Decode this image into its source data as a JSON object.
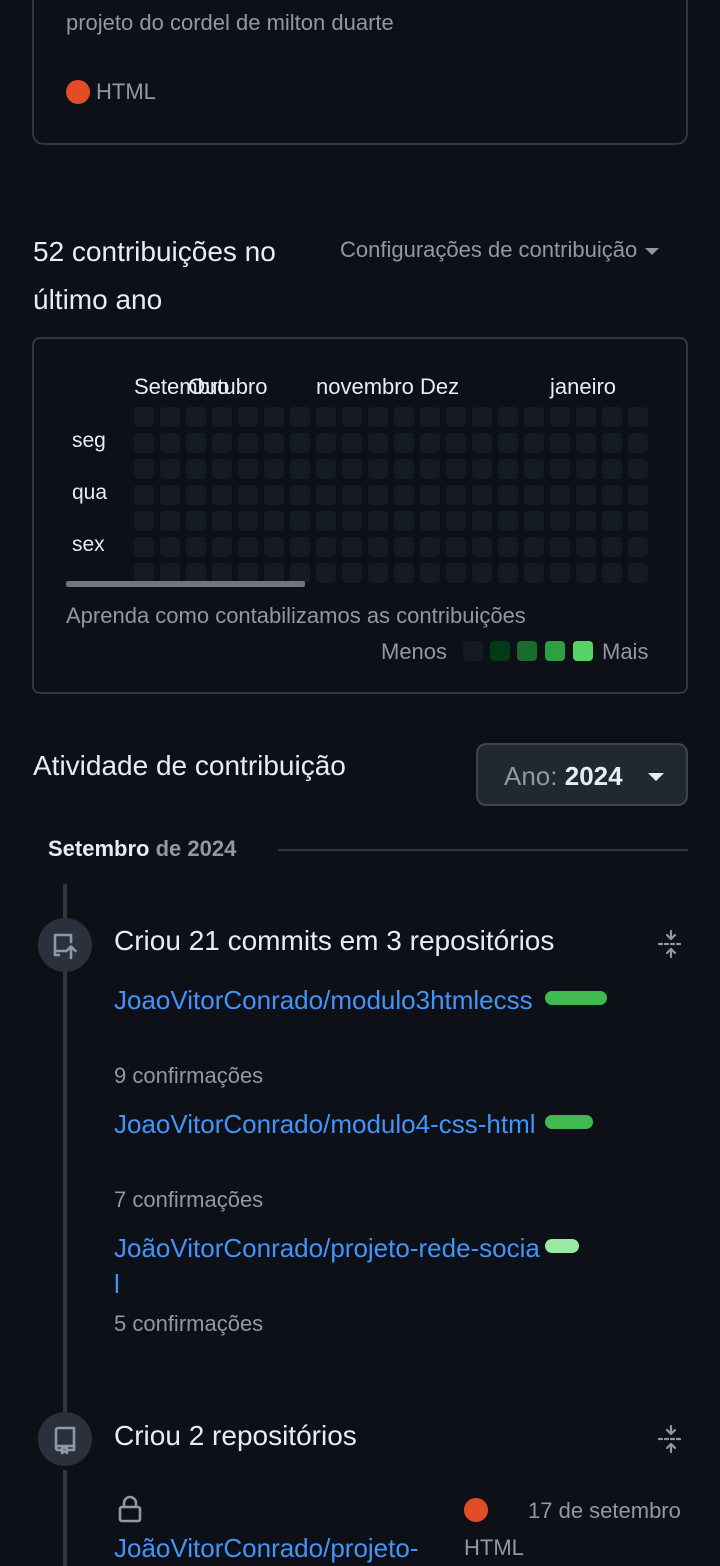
{
  "repo_card": {
    "description": "projeto do cordel de milton duarte",
    "language": "HTML",
    "language_color": "#e34c26"
  },
  "contributions": {
    "heading": "52 contribuições no último ano",
    "settings_label": "Configurações de contribuição",
    "months": [
      "Setembro",
      "Outubro",
      "novembro",
      "Dez",
      "janeiro"
    ],
    "days": [
      "seg",
      "qua",
      "sex"
    ],
    "learn_link": "Aprenda como contabilizamos as contribuições",
    "legend_less": "Menos",
    "legend_more": "Mais",
    "legend_colors": [
      "#151b23",
      "#033a16",
      "#196c2e",
      "#2ea043",
      "#56d364"
    ]
  },
  "activity": {
    "title": "Atividade de contribuição",
    "year_label": "Ano:",
    "year_value": "2024",
    "month_name": "Setembro",
    "month_year": "de 2024",
    "commits_event": {
      "title": "Criou 21 commits em 3 repositórios",
      "repos": [
        {
          "name": "JoaoVitorConrado/modulo3htmlecss",
          "commits": "9 confirmações",
          "level": 9
        },
        {
          "name": "JoaoVitorConrado/modulo4-css-html",
          "commits": "7 confirmações",
          "level": 7
        },
        {
          "name": "JoãoVitorConrado/projeto-rede-social",
          "commits": "5 confirmações",
          "level": 5
        }
      ]
    },
    "repos_event": {
      "title": "Criou 2 repositórios",
      "repo_name": "JoãoVitorConrado/projeto-",
      "language": "HTML",
      "date": "17 de setembro"
    }
  }
}
